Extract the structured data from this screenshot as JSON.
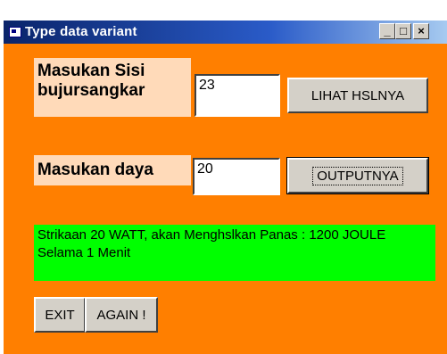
{
  "window": {
    "title": "Type data variant",
    "controls": {
      "minimize": "_",
      "maximize": "□",
      "close": "×"
    }
  },
  "form": {
    "label_side": "Masukan Sisi bujursangkar",
    "side_value": "23",
    "btn_view_result": "LIHAT HSLNYA",
    "label_power": "Masukan daya",
    "power_value": "20",
    "btn_output": "OUTPUTNYA",
    "result_text": "Strikaan  20 WATT, akan Menghslkan Panas : 1200 JOULE Selama 1 Menit",
    "btn_exit": "EXIT",
    "btn_again": "AGAIN !"
  },
  "colors": {
    "form_background": "#ff7f00",
    "label_background": "#ffdab9",
    "result_background": "#00ff00",
    "titlebar": "#0a246a"
  }
}
